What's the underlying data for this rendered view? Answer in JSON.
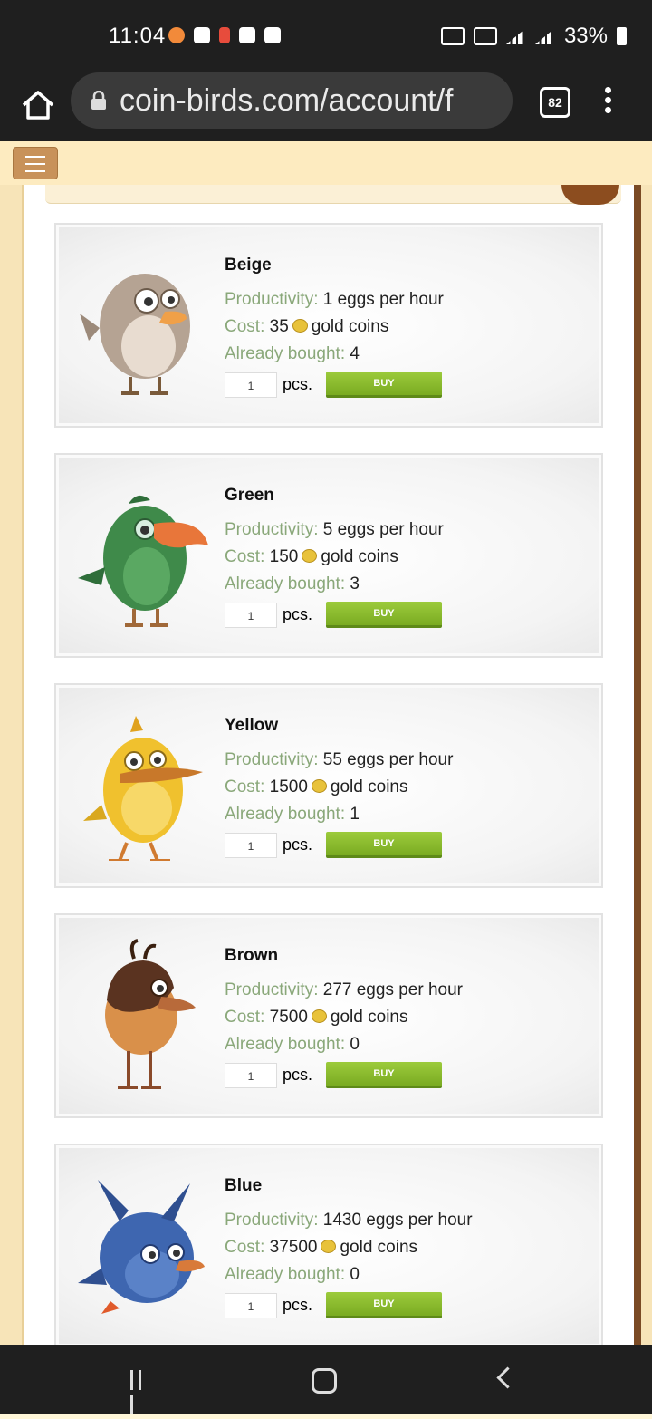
{
  "status_bar": {
    "time": "11:04",
    "battery": "33%"
  },
  "browser": {
    "url": "coin-birds.com/account/f",
    "tab_count": "82"
  },
  "birds": [
    {
      "name": "Beige",
      "productivity_label": "Productivity:",
      "productivity": "1 eggs per hour",
      "cost_label": "Cost:",
      "cost": "35",
      "cost_unit": "gold coins",
      "bought_label": "Already bought:",
      "bought": "4",
      "qty": "1",
      "pcs": "pcs.",
      "buy": "BUY",
      "color": "#b5a393"
    },
    {
      "name": "Green",
      "productivity_label": "Productivity:",
      "productivity": "5 eggs per hour",
      "cost_label": "Cost:",
      "cost": "150",
      "cost_unit": "gold coins",
      "bought_label": "Already bought:",
      "bought": "3",
      "qty": "1",
      "pcs": "pcs.",
      "buy": "BUY",
      "color": "#3f8a4a"
    },
    {
      "name": "Yellow",
      "productivity_label": "Productivity:",
      "productivity": "55 eggs per hour",
      "cost_label": "Cost:",
      "cost": "1500",
      "cost_unit": "gold coins",
      "bought_label": "Already bought:",
      "bought": "1",
      "qty": "1",
      "pcs": "pcs.",
      "buy": "BUY",
      "color": "#f0c12e"
    },
    {
      "name": "Brown",
      "productivity_label": "Productivity:",
      "productivity": "277 eggs per hour",
      "cost_label": "Cost:",
      "cost": "7500",
      "cost_unit": "gold coins",
      "bought_label": "Already bought:",
      "bought": "0",
      "qty": "1",
      "pcs": "pcs.",
      "buy": "BUY",
      "color": "#7a4a2a"
    },
    {
      "name": "Blue",
      "productivity_label": "Productivity:",
      "productivity": "1430 eggs per hour",
      "cost_label": "Cost:",
      "cost": "37500",
      "cost_unit": "gold coins",
      "bought_label": "Already bought:",
      "bought": "0",
      "qty": "1",
      "pcs": "pcs.",
      "buy": "BUY",
      "color": "#3e66b0"
    }
  ]
}
